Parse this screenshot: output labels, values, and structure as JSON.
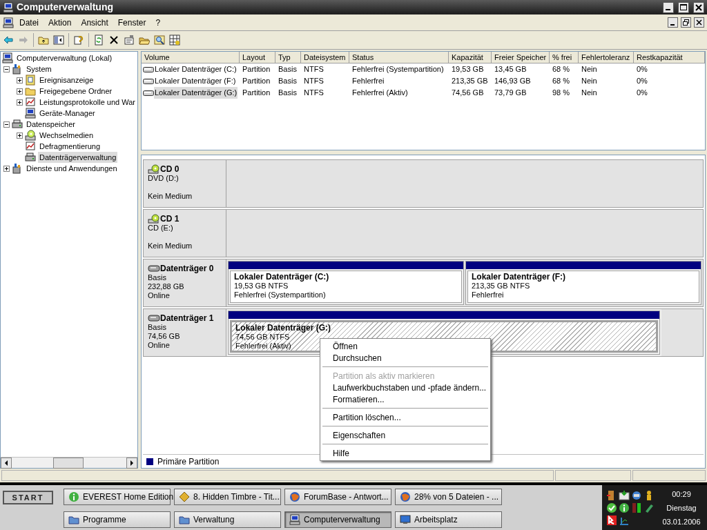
{
  "window": {
    "title": "Computerverwaltung"
  },
  "menu": [
    "Datei",
    "Aktion",
    "Ansicht",
    "Fenster",
    "?"
  ],
  "tree": [
    {
      "label": "Computerverwaltung (Lokal)",
      "kind": "computer",
      "selected": false,
      "children": [
        {
          "label": "System",
          "kind": "tools",
          "expanded": true,
          "selected": false,
          "children": [
            {
              "label": "Ereignisanzeige",
              "kind": "log",
              "expanded": false,
              "selected": false
            },
            {
              "label": "Freigegebene Ordner",
              "kind": "folder",
              "expanded": false,
              "selected": false
            },
            {
              "label": "Leistungsprotokolle und War",
              "kind": "chart",
              "expanded": false,
              "selected": false
            },
            {
              "label": "Geräte-Manager",
              "kind": "computer",
              "selected": false
            }
          ]
        },
        {
          "label": "Datenspeicher",
          "kind": "storage",
          "expanded": true,
          "selected": false,
          "children": [
            {
              "label": "Wechselmedien",
              "kind": "cd",
              "expanded": false,
              "selected": false
            },
            {
              "label": "Defragmentierung",
              "kind": "chart",
              "selected": false
            },
            {
              "label": "Datenträgerverwaltung",
              "kind": "storage",
              "selected": true
            }
          ]
        },
        {
          "label": "Dienste und Anwendungen",
          "kind": "tools",
          "expanded": false,
          "selected": false
        }
      ]
    }
  ],
  "table": {
    "columns": [
      "Volume",
      "Layout",
      "Typ",
      "Dateisystem",
      "Status",
      "Kapazität",
      "Freier Speicher",
      "% frei",
      "Fehlertoleranz",
      "Restkapazität"
    ],
    "rows": [
      {
        "selected": false,
        "cells": [
          "Lokaler Datenträger (C:)",
          "Partition",
          "Basis",
          "NTFS",
          "Fehlerfrei (Systempartition)",
          "19,53 GB",
          "13,45 GB",
          "68 %",
          "Nein",
          "0%"
        ]
      },
      {
        "selected": false,
        "cells": [
          "Lokaler Datenträger (F:)",
          "Partition",
          "Basis",
          "NTFS",
          "Fehlerfrei",
          "213,35 GB",
          "146,93 GB",
          "68 %",
          "Nein",
          "0%"
        ]
      },
      {
        "selected": true,
        "cells": [
          "Lokaler Datenträger (G:)",
          "Partition",
          "Basis",
          "NTFS",
          "Fehlerfrei (Aktiv)",
          "74,56 GB",
          "73,79 GB",
          "98 %",
          "Nein",
          "0%"
        ]
      }
    ]
  },
  "disks": [
    {
      "kind": "cd",
      "name": "CD 0",
      "lines": [
        "DVD (D:)",
        "Kein Medium"
      ]
    },
    {
      "kind": "cd",
      "name": "CD 1",
      "lines": [
        "CD (E:)",
        "Kein Medium"
      ]
    },
    {
      "kind": "disk",
      "name": "Datenträger 0",
      "lines": [
        "Basis",
        "232,88 GB",
        "Online"
      ],
      "partitions": [
        {
          "name": "Lokaler Datenträger  (C:)",
          "size": "19,53 GB NTFS",
          "status": "Fehlerfrei (Systempartition)",
          "selected": false
        },
        {
          "name": "Lokaler Datenträger  (F:)",
          "size": "213,35 GB NTFS",
          "status": "Fehlerfrei",
          "selected": false
        }
      ]
    },
    {
      "kind": "disk",
      "name": "Datenträger 1",
      "lines": [
        "Basis",
        "74,56 GB",
        "Online"
      ],
      "partitions": [
        {
          "name": "Lokaler Datenträger  (G:)",
          "size": "74,56 GB NTFS",
          "status": "Fehlerfrei (Aktiv)",
          "selected": true
        }
      ]
    }
  ],
  "legend": {
    "label": "Primäre Partition",
    "color": "#000080"
  },
  "context_menu": [
    {
      "kind": "item",
      "label": "Öffnen",
      "disabled": false
    },
    {
      "kind": "item",
      "label": "Durchsuchen",
      "disabled": false
    },
    {
      "kind": "separator"
    },
    {
      "kind": "item",
      "label": "Partition als aktiv markieren",
      "disabled": true
    },
    {
      "kind": "item",
      "label": "Laufwerkbuchstaben und -pfade ändern...",
      "disabled": false
    },
    {
      "kind": "item",
      "label": "Formatieren...",
      "disabled": false
    },
    {
      "kind": "separator"
    },
    {
      "kind": "item",
      "label": "Partition löschen...",
      "disabled": false
    },
    {
      "kind": "separator"
    },
    {
      "kind": "item",
      "label": "Eigenschaften",
      "disabled": false
    },
    {
      "kind": "separator"
    },
    {
      "kind": "item",
      "label": "Hilfe",
      "disabled": false
    }
  ],
  "taskbar": {
    "start": "START",
    "tasks": [
      {
        "label": "EVEREST Home Edition",
        "kind": "info",
        "selected": false
      },
      {
        "label": "8. Hidden Timbre - Tit...",
        "kind": "music",
        "selected": false
      },
      {
        "label": "ForumBase - Antwort...",
        "kind": "globe",
        "selected": false
      },
      {
        "label": "28% von 5 Dateien - ...",
        "kind": "globe",
        "selected": false
      },
      {
        "label": "Programme",
        "kind": "folder",
        "selected": false
      },
      {
        "label": "Verwaltung",
        "kind": "folder",
        "selected": false
      },
      {
        "label": "Computerverwaltung",
        "kind": "computer",
        "selected": true
      },
      {
        "label": "Arbeitsplatz",
        "kind": "monitor",
        "selected": false
      }
    ],
    "clock": [
      "00:29",
      "Dienstag",
      "03.01.2006"
    ]
  }
}
